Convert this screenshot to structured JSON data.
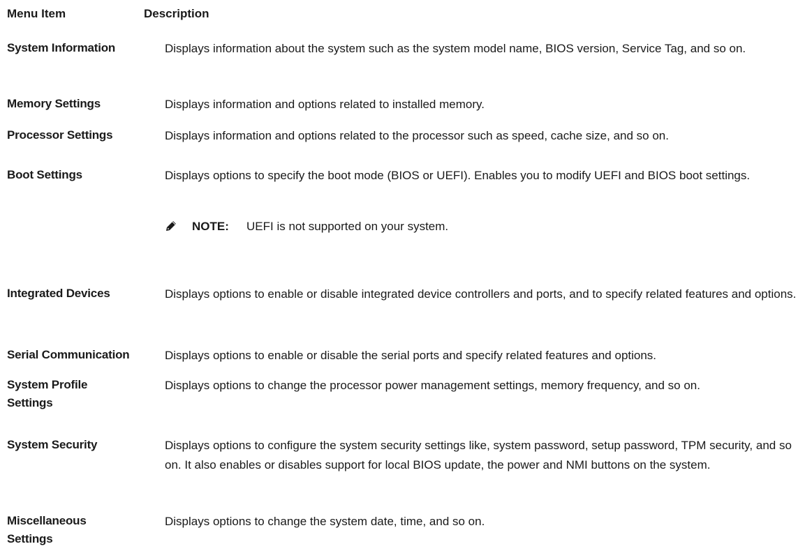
{
  "table": {
    "header": {
      "menu_item": "Menu Item",
      "description": "Description"
    },
    "rows": [
      {
        "item": "System Information",
        "description": "Displays information about the system such as the system model name, BIOS version, Service Tag, and so on."
      },
      {
        "item": "Memory Settings",
        "description": "Displays information and options related to installed memory."
      },
      {
        "item": "Processor Settings",
        "description": "Displays information and options related to the processor such as speed, cache size, and so on."
      },
      {
        "item": "Boot Settings",
        "description": "Displays options to specify the boot mode (BIOS or UEFI). Enables you to modify UEFI and BIOS boot settings."
      },
      {
        "item": "Integrated Devices",
        "description": "Displays options to enable or disable integrated device controllers and ports, and to specify related features and options."
      },
      {
        "item": "Serial Communication",
        "description": "Displays options to enable or disable the serial ports and specify related features and options."
      },
      {
        "item": "System Profile Settings",
        "description": "Displays options to change the processor power management settings, memory frequency, and so on."
      },
      {
        "item": "System Security",
        "description": "Displays options to configure the system security settings like, system password, setup password, TPM security, and so on. It also enables or disables support for local BIOS update, the power and NMI buttons on the system."
      },
      {
        "item": "Miscellaneous Settings",
        "description": "Displays options to change the system date, time, and so on."
      }
    ],
    "note": {
      "icon": "pencil-note-icon",
      "label": "NOTE:",
      "text": "UEFI is not supported on your system."
    }
  }
}
